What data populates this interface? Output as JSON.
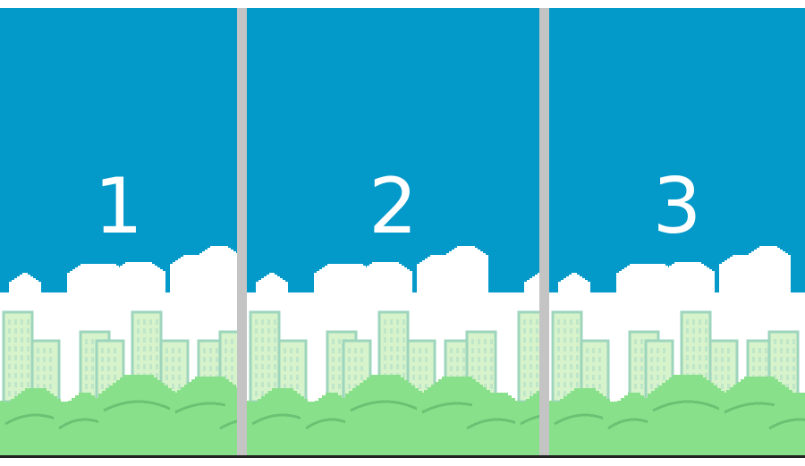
{
  "colors": {
    "sky": "#0399c9",
    "cloud": "#ffffff",
    "building_fill": "#d7f3cb",
    "building_outline": "#9ed5bd",
    "window": "#bfe6c8",
    "bush": "#88e08a",
    "bush_line": "#6cc274",
    "divider": "#c4c4c4"
  },
  "panels": [
    {
      "number": "1"
    },
    {
      "number": "2"
    },
    {
      "number": "3"
    }
  ]
}
